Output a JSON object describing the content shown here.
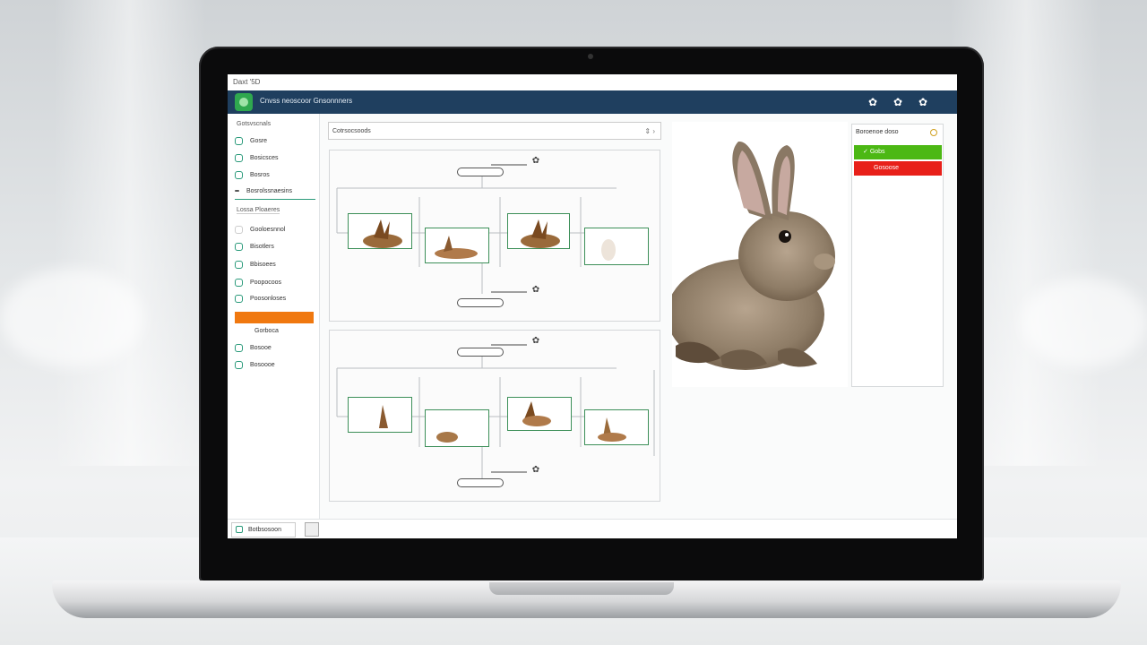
{
  "window": {
    "title": "Daxt '5D"
  },
  "app": {
    "title": "Cnvss neoscoor Gnsonnners"
  },
  "header_icons": [
    "gear-icon",
    "gear-icon",
    "gear-icon"
  ],
  "sidebar": {
    "heading": "Gotsvscnals",
    "items": [
      {
        "label": "Gosre",
        "active": false
      },
      {
        "label": "Bosicsces",
        "active": false
      },
      {
        "label": "Bosros",
        "active": false
      },
      {
        "label": "Bosrolssnaesins",
        "active": false
      }
    ],
    "section_label": "Lossa Ploaeres",
    "items2": [
      {
        "label": "Gooloesnnol",
        "active": false
      },
      {
        "label": "Bisotlers",
        "active": false
      },
      {
        "label": "Bbisoees",
        "active": false
      },
      {
        "label": "Poopocoos",
        "active": false
      },
      {
        "label": "Poosonloses",
        "active": false
      },
      {
        "label": "",
        "active": true
      }
    ],
    "sub_label": "Gorboca",
    "items3": [
      {
        "label": "Bosooe",
        "active": false
      },
      {
        "label": "Bosoooe",
        "active": false
      }
    ]
  },
  "search": {
    "value": "Cotrsocsoods"
  },
  "properties": {
    "heading": "Boroenoe doso",
    "success_label": "Gobs",
    "error_label": "Gosoose",
    "success_color": "#4cb814",
    "error_color": "#e8201a"
  },
  "bottom": {
    "button_label": "Botbsosoon"
  },
  "colors": {
    "appbar": "#1f3f5f",
    "accent": "#f0780f",
    "node_border": "#3c8f58"
  }
}
